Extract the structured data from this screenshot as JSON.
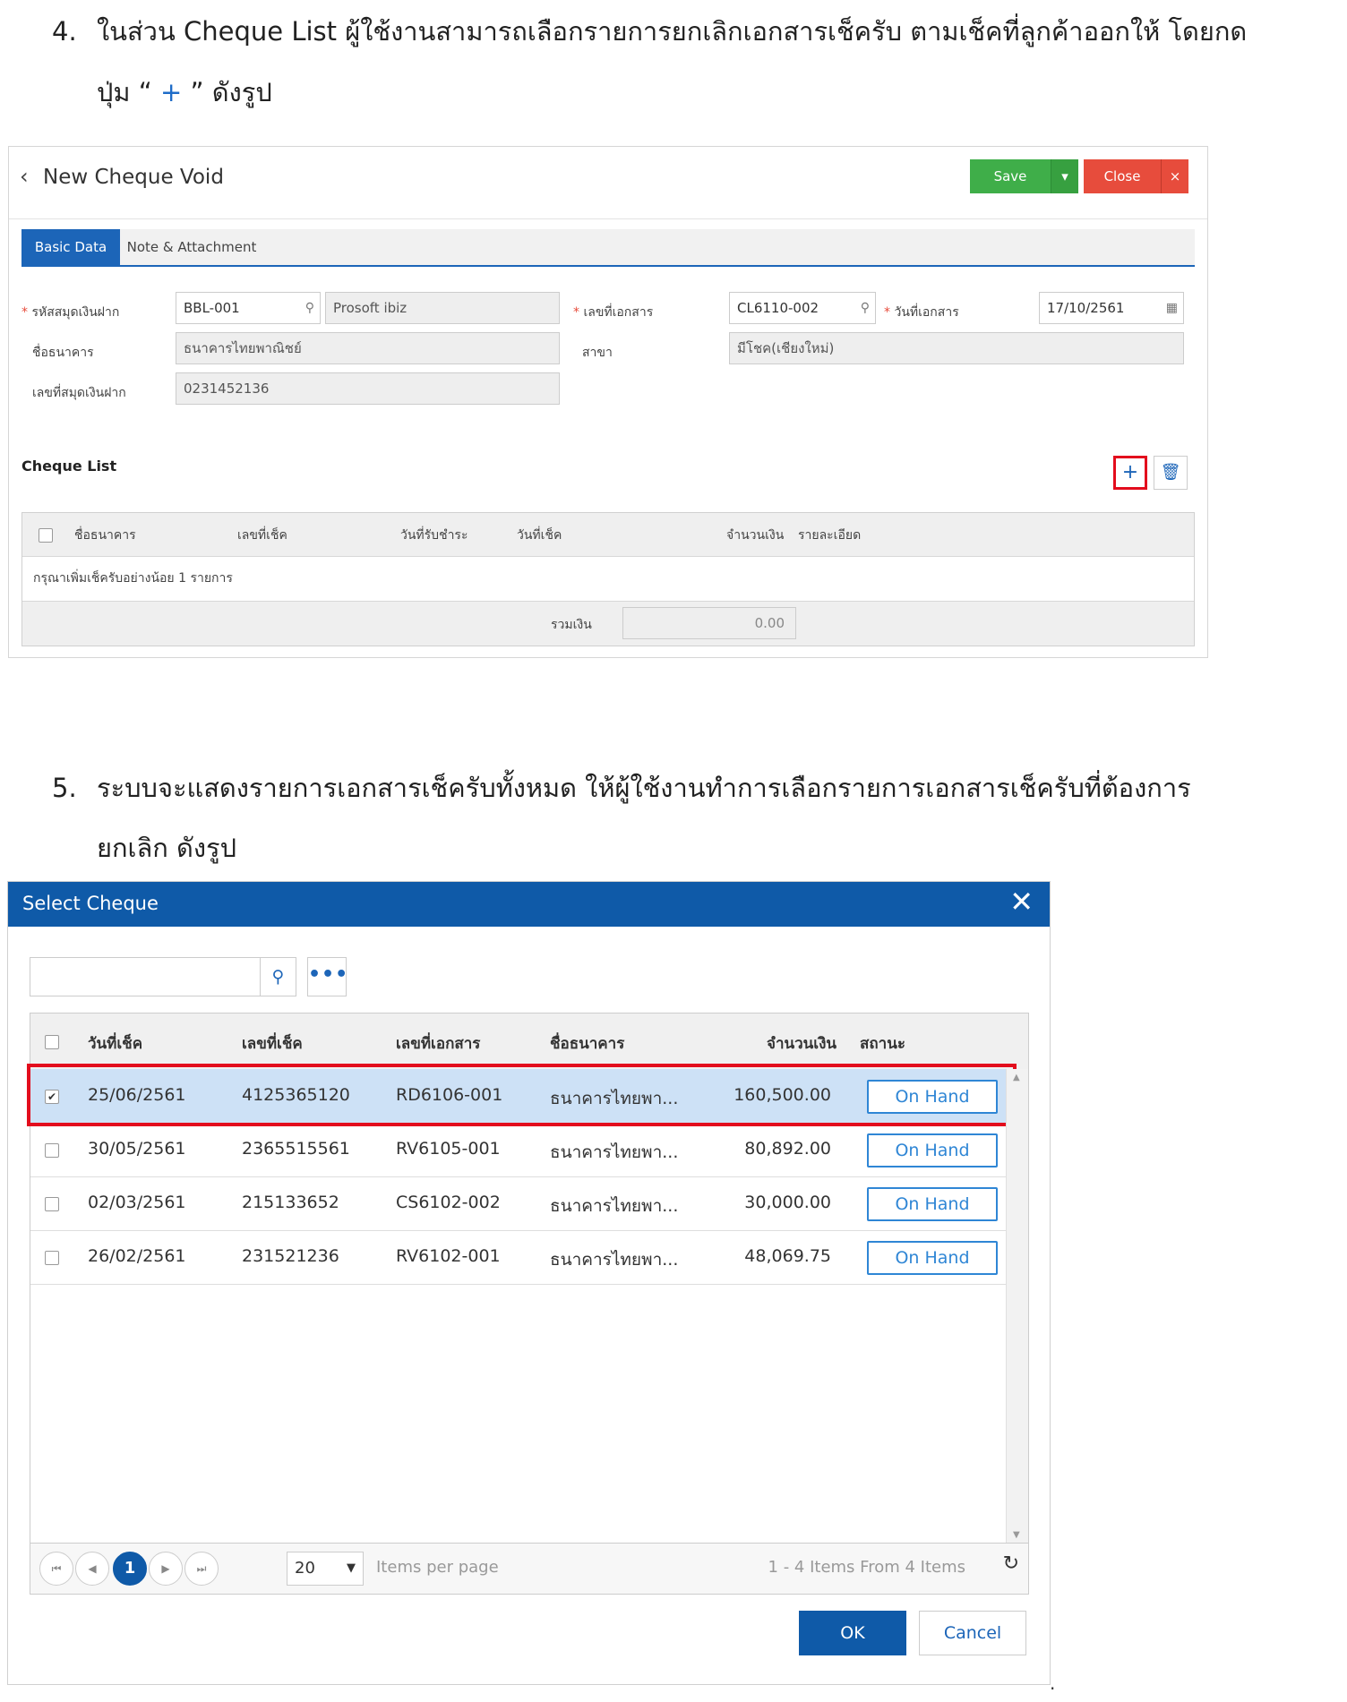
{
  "step4": {
    "number": "4.",
    "line1": "ในส่วน Cheque List ผู้ใช้งานสามารถเลือกรายการยกเลิกเอกสารเช็ครับ ตามเช็คที่ลูกค้าออกให้ โดยกด",
    "line2_pre": "ปุ่ม “ ",
    "line2_sym": "+",
    "line2_post": " ” ดังรูป"
  },
  "form": {
    "back_icon": "chevron-left-icon",
    "title": "New Cheque Void",
    "save_label": "Save",
    "close_label": "Close",
    "close_x": "×",
    "tabs": [
      "Basic Data",
      "Note & Attachment"
    ],
    "fields": {
      "passbook_label": "รหัสสมุดเงินฝาก",
      "passbook_code": "BBL-001",
      "passbook_name": "Prosoft ibiz",
      "doc_no_label": "เลขที่เอกสาร",
      "doc_no": "CL6110-002",
      "doc_date_label": "วันที่เอกสาร",
      "doc_date": "17/10/2561",
      "bank_label": "ชื่อธนาคาร",
      "bank": "ธนาคารไทยพาณิชย์",
      "branch_label": "สาขา",
      "branch": "มีโชค(เชียงใหม่)",
      "account_label": "เลขที่สมุดเงินฝาก",
      "account": "0231452136"
    },
    "cheque_list": {
      "title": "Cheque List",
      "add_symbol": "+",
      "columns": [
        "ชื่อธนาคาร",
        "เลขที่เช็ค",
        "วันที่รับชำระ",
        "วันที่เช็ค",
        "จำนวนเงิน",
        "รายละเอียด"
      ],
      "empty_message": "กรุณาเพิ่มเช็ครับอย่างน้อย 1 รายการ",
      "total_label": "รวมเงิน",
      "total_value": "0.00"
    }
  },
  "step5": {
    "number": "5.",
    "line1": "ระบบจะแสดงรายการเอกสารเช็ครับทั้งหมด ให้ผู้ใช้งานทำการเลือกรายการเอกสารเช็ครับที่ต้องการ",
    "line2": "ยกเลิก ดังรูป"
  },
  "dialog": {
    "title": "Select Cheque",
    "close_x": "✕",
    "search_placeholder": "",
    "more_label": "•••",
    "columns": [
      "วันที่เช็ค",
      "เลขที่เช็ค",
      "เลขที่เอกสาร",
      "ชื่อธนาคาร",
      "จำนวนเงิน",
      "สถานะ"
    ],
    "rows": [
      {
        "date": "25/06/2561",
        "cheque_no": "4125365120",
        "doc_no": "RD6106-001",
        "bank": "ธนาคารไทยพา...",
        "amount": "160,500.00",
        "status": "On Hand",
        "checked": true
      },
      {
        "date": "30/05/2561",
        "cheque_no": "2365515561",
        "doc_no": "RV6105-001",
        "bank": "ธนาคารไทยพา...",
        "amount": "80,892.00",
        "status": "On Hand",
        "checked": false
      },
      {
        "date": "02/03/2561",
        "cheque_no": "215133652",
        "doc_no": "CS6102-002",
        "bank": "ธนาคารไทยพา...",
        "amount": "30,000.00",
        "status": "On Hand",
        "checked": false
      },
      {
        "date": "26/02/2561",
        "cheque_no": "231521236",
        "doc_no": "RV6102-001",
        "bank": "ธนาคารไทยพา...",
        "amount": "48,069.75",
        "status": "On Hand",
        "checked": false
      }
    ],
    "pager": {
      "current_page": "1",
      "page_size": "20",
      "page_size_label": "Items per page",
      "info": "1 - 4 Items From 4 Items"
    },
    "ok_label": "OK",
    "cancel_label": "Cancel"
  },
  "trailing_mark": "."
}
